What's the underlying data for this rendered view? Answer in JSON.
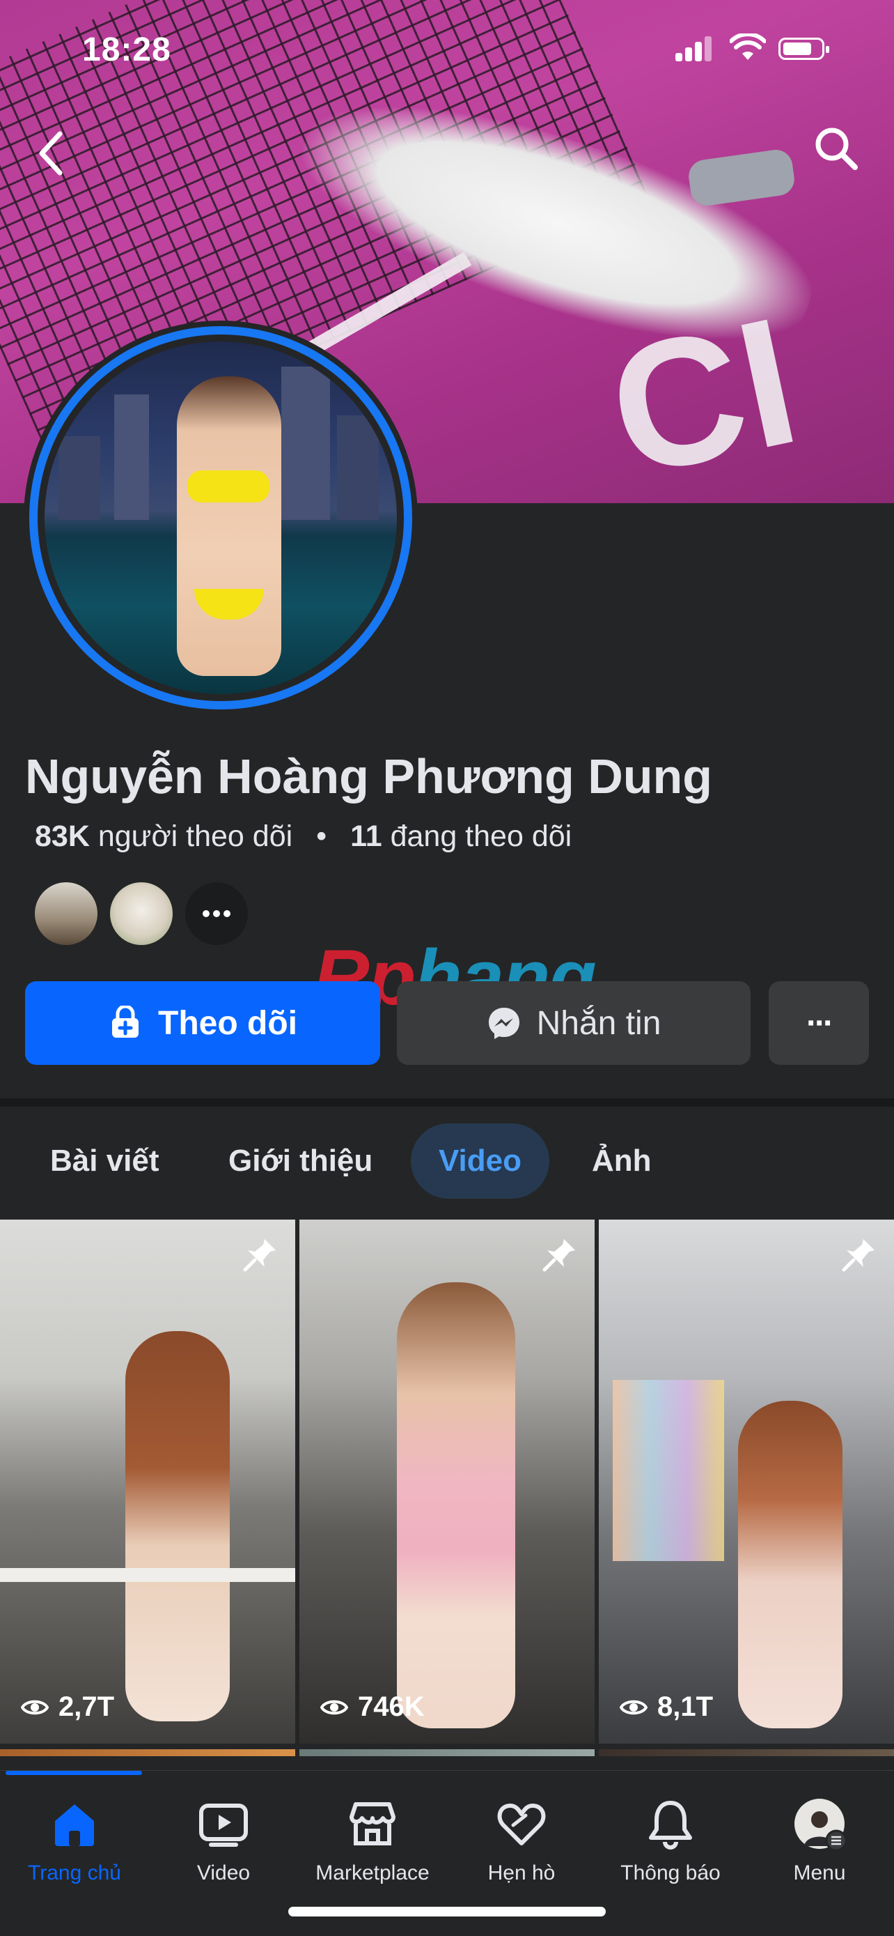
{
  "status_bar": {
    "time": "18:28"
  },
  "profile": {
    "name": "Nguyễn Hoàng Phương Dung",
    "followers_count": "83K",
    "followers_label": "người theo dõi",
    "following_count": "11",
    "following_label": "đang theo dõi",
    "separator": "•"
  },
  "watermark": {
    "part1": "Rp",
    "part2": "hang"
  },
  "actions": {
    "follow_label": "Theo dõi",
    "message_label": "Nhắn tin",
    "more_label": "···"
  },
  "tabs": [
    {
      "label": "Bài viết",
      "active": false
    },
    {
      "label": "Giới thiệu",
      "active": false
    },
    {
      "label": "Video",
      "active": true
    },
    {
      "label": "Ảnh",
      "active": false
    }
  ],
  "videos": [
    {
      "views": "2,7T",
      "pinned": true
    },
    {
      "views": "746K",
      "pinned": true
    },
    {
      "views": "8,1T",
      "pinned": true
    }
  ],
  "bottom_nav": [
    {
      "label": "Trang chủ",
      "icon": "home-icon",
      "active": true
    },
    {
      "label": "Video",
      "icon": "video-icon",
      "active": false
    },
    {
      "label": "Marketplace",
      "icon": "marketplace-icon",
      "active": false
    },
    {
      "label": "Hẹn hò",
      "icon": "dating-heart-icon",
      "active": false
    },
    {
      "label": "Thông báo",
      "icon": "bell-icon",
      "active": false
    },
    {
      "label": "Menu",
      "icon": "menu-avatar",
      "active": false
    }
  ],
  "colors": {
    "accent": "#0866ff",
    "background": "#242526",
    "button_secondary": "#3a3b3c",
    "tab_active_bg": "#263951",
    "tab_active_text": "#4a9df5"
  }
}
